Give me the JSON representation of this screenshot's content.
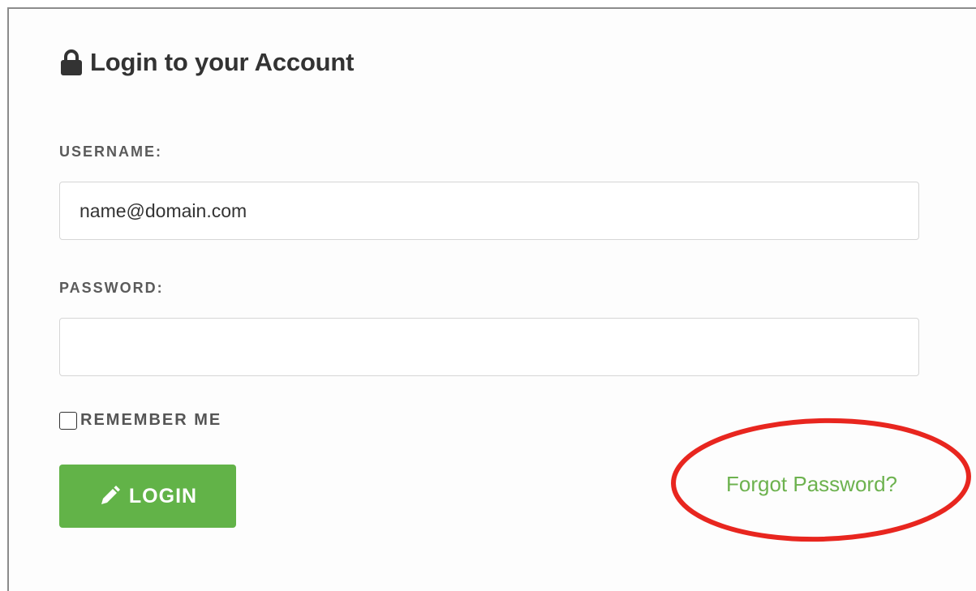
{
  "login_form": {
    "title": "Login to your Account",
    "username_label": "USERNAME:",
    "username_value": "name@domain.com",
    "password_label": "PASSWORD:",
    "password_value": "",
    "remember_label": "REMEMBER ME",
    "remember_checked": false,
    "login_button_label": "LOGIN",
    "forgot_password_label": "Forgot Password?"
  },
  "icons": {
    "title_icon": "lock-icon",
    "login_icon": "pencil-icon"
  },
  "colors": {
    "accent_green": "#62b348",
    "link_green": "#6db24f",
    "annotation_red": "#e8261f",
    "title_text": "#333333",
    "label_text": "#5a5a5a"
  }
}
